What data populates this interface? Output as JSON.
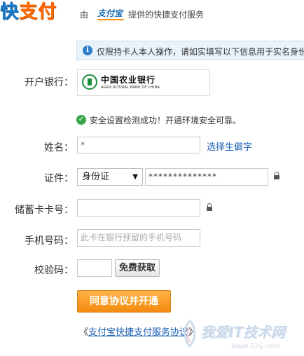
{
  "header": {
    "logo_part_cut": "快",
    "logo_main": "支付",
    "by": "由",
    "brand": "支付宝",
    "provided": "提供的快捷支付服务"
  },
  "notice": {
    "icon": "info-icon",
    "text": "仅限持卡人本人操作，请如实填写以下信息用于实名身份"
  },
  "form": {
    "bank": {
      "label": "开户银行：",
      "name_cn": "中国农业银行",
      "name_en": "AGRICULTURAL BANK OF CHINA"
    },
    "security_check": {
      "icon": "check-icon",
      "text": "安全设置检测成功！开通环境安全可靠。"
    },
    "name": {
      "label": "姓名：",
      "value": "*",
      "link": "选择生僻字"
    },
    "id": {
      "label": "证件：",
      "type": "身份证",
      "value": "**************"
    },
    "card": {
      "label": "储蓄卡卡号：",
      "value": ""
    },
    "phone": {
      "label": "手机号码：",
      "placeholder": "此卡在银行预留的手机号码"
    },
    "code": {
      "label": "校验码：",
      "value": "",
      "button": "免费获取"
    },
    "submit": "同意协议并开通",
    "agreement": {
      "prefix": "《",
      "link": "支付宝快捷支付服务协议",
      "suffix": "》"
    }
  },
  "watermark": {
    "text": "我爱IT技术网",
    "url": "www.52ij.com"
  },
  "colors": {
    "accent_orange": "#f48a0e",
    "link_blue": "#1a5fb4",
    "success_green": "#3aa64a",
    "notice_bg": "#e9f3fb",
    "bank_green": "#1a8f3c"
  }
}
